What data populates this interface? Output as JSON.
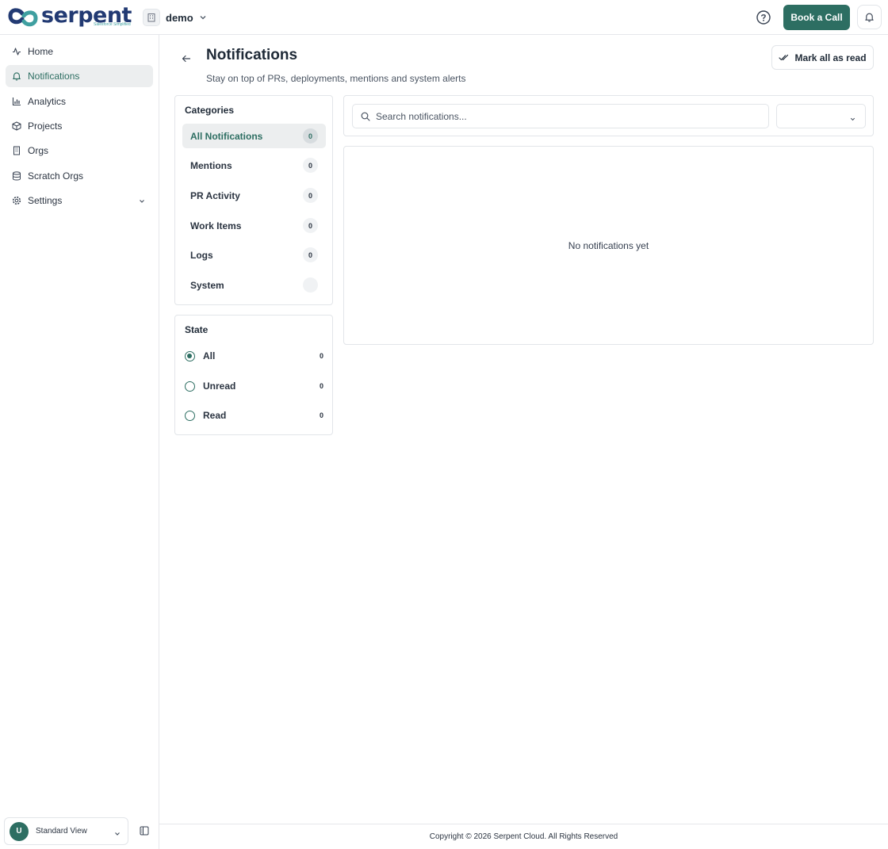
{
  "header": {
    "logo_text": "serpent",
    "logo_tagline": "Salesforce Simplified",
    "workspace_name": "demo",
    "book_call_label": "Book a Call"
  },
  "sidebar": {
    "items": [
      {
        "label": "Home",
        "icon": "activity-icon"
      },
      {
        "label": "Notifications",
        "icon": "bell-icon",
        "active": true
      },
      {
        "label": "Analytics",
        "icon": "bar-chart-icon"
      },
      {
        "label": "Projects",
        "icon": "package-icon"
      },
      {
        "label": "Orgs",
        "icon": "building-icon"
      },
      {
        "label": "Scratch Orgs",
        "icon": "database-icon"
      },
      {
        "label": "Settings",
        "icon": "gear-icon"
      }
    ],
    "footer": {
      "avatar_initial": "U",
      "view_label": "Standard View"
    }
  },
  "page": {
    "title": "Notifications",
    "subtitle": "Stay on top of PRs, deployments, mentions and system alerts",
    "mark_all_label": "Mark all as read"
  },
  "categories": {
    "title": "Categories",
    "items": [
      {
        "label": "All Notifications",
        "count": "0",
        "active": true
      },
      {
        "label": "Mentions",
        "count": "0"
      },
      {
        "label": "PR Activity",
        "count": "0"
      },
      {
        "label": "Work Items",
        "count": "0"
      },
      {
        "label": "Logs",
        "count": "0"
      },
      {
        "label": "System",
        "count": ""
      }
    ]
  },
  "state": {
    "title": "State",
    "items": [
      {
        "label": "All",
        "count": "0",
        "checked": true
      },
      {
        "label": "Unread",
        "count": "0"
      },
      {
        "label": "Read",
        "count": "0"
      }
    ]
  },
  "filters": {
    "search_placeholder": "Search notifications...",
    "select_value": ""
  },
  "empty_state": "No notifications yet",
  "footer": {
    "copyright": "Copyright © 2026 Serpent Cloud. All Rights Reserved"
  },
  "colors": {
    "brand": "#2d6e62",
    "logo_text": "#223a73",
    "active_bg": "#eceeef"
  }
}
